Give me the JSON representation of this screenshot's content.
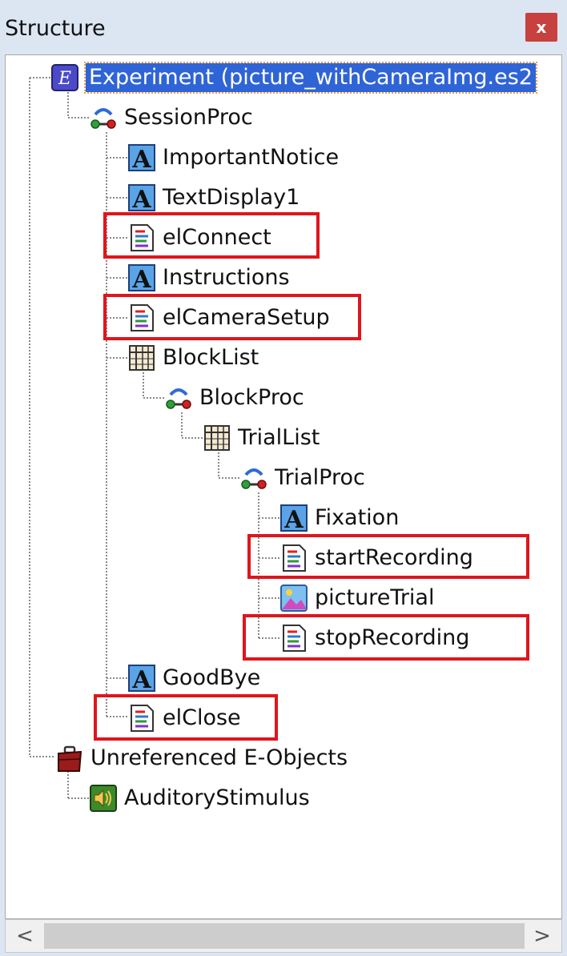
{
  "panel": {
    "title": "Structure",
    "close_label": "x"
  },
  "tree": {
    "experiment": "Experiment (picture_withCameraImg.es2",
    "session_proc": "SessionProc",
    "important_notice": "ImportantNotice",
    "text_display1": "TextDisplay1",
    "el_connect": "elConnect",
    "instructions": "Instructions",
    "el_camera_setup": "elCameraSetup",
    "block_list": "BlockList",
    "block_proc": "BlockProc",
    "trial_list": "TrialList",
    "trial_proc": "TrialProc",
    "fixation": "Fixation",
    "start_recording": "startRecording",
    "picture_trial": "pictureTrial",
    "stop_recording": "stopRecording",
    "goodbye": "GoodBye",
    "el_close": "elClose",
    "unreferenced": "Unreferenced E-Objects",
    "auditory_stimulus": "AuditoryStimulus"
  },
  "scrollbar": {
    "left_arrow": "<",
    "right_arrow": ">"
  },
  "colors": {
    "highlight": "#e0151c",
    "selection": "#2f64d6",
    "close_button": "#c7413e"
  }
}
